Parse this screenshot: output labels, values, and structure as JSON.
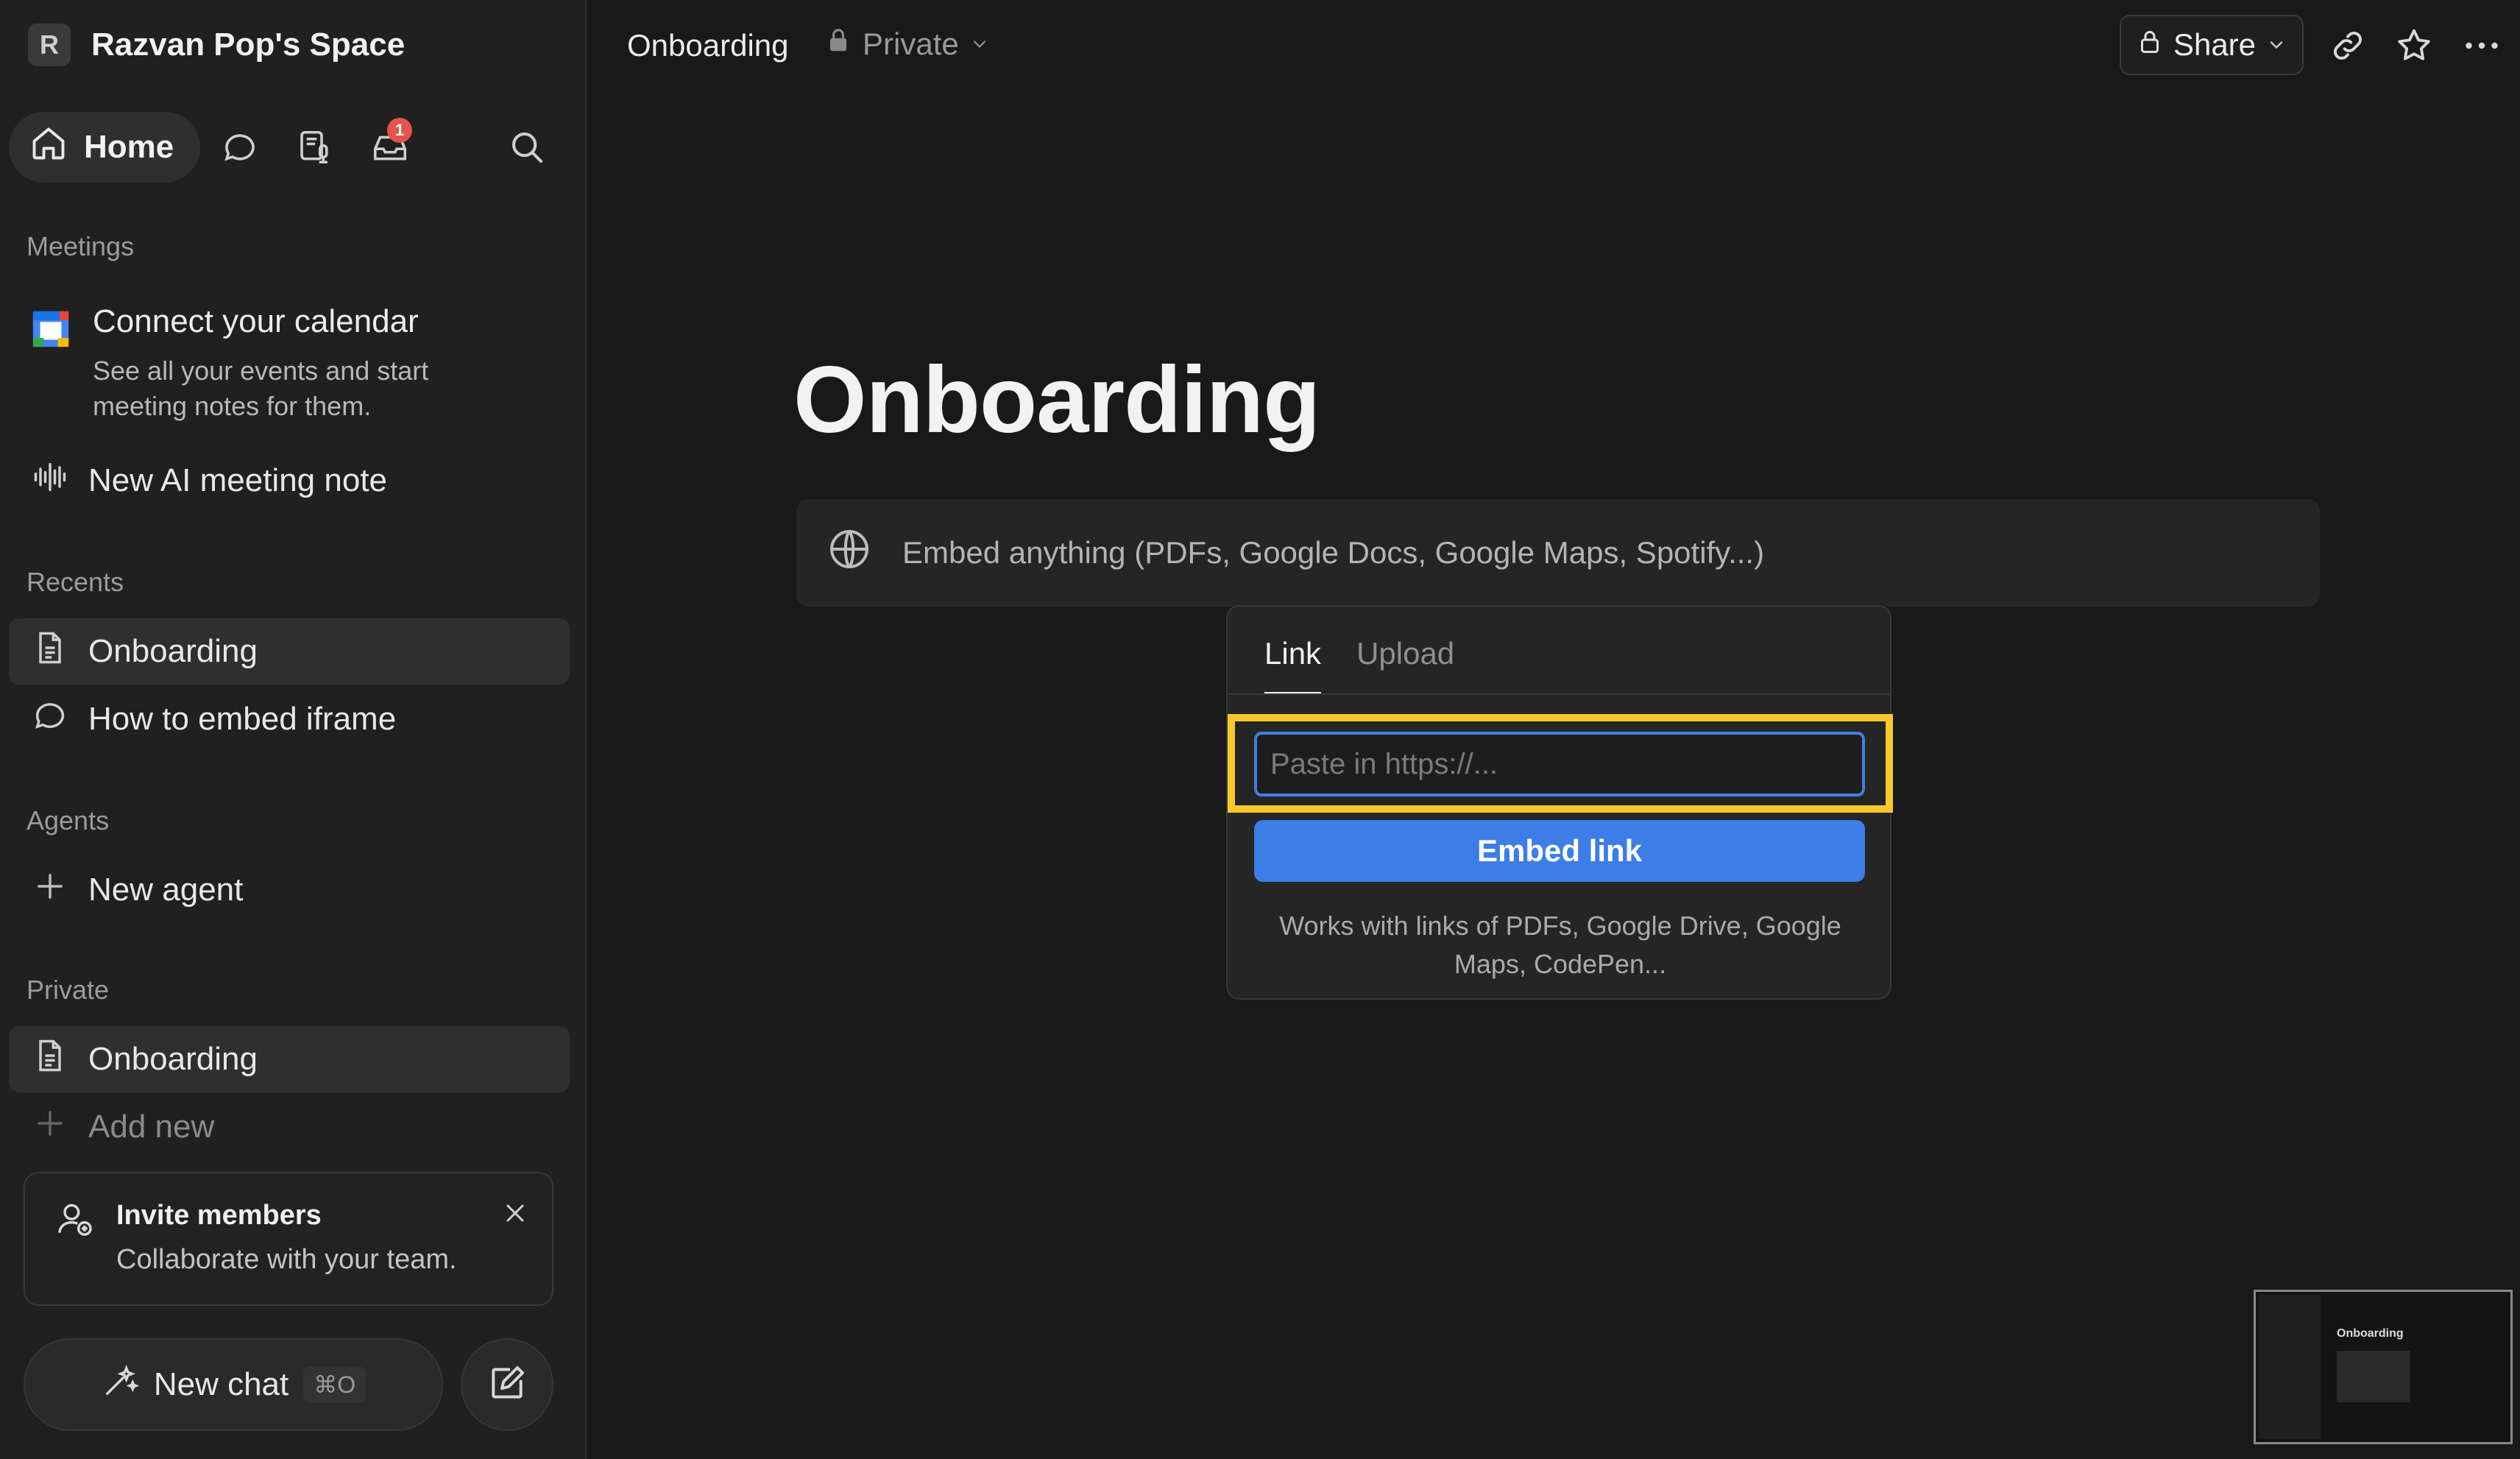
{
  "workspace": {
    "initial": "R",
    "name": "Razvan Pop's Space"
  },
  "nav": {
    "home_label": "Home",
    "inbox_badge": "1"
  },
  "meetings": {
    "section": "Meetings",
    "connect_title": "Connect your calendar",
    "connect_desc": "See all your events and start meeting notes for them.",
    "new_note": "New AI meeting note"
  },
  "recents": {
    "section": "Recents",
    "items": [
      {
        "label": "Onboarding",
        "icon": "page-icon"
      },
      {
        "label": "How to embed iframe",
        "icon": "chat-bubble-icon"
      }
    ]
  },
  "agents": {
    "section": "Agents",
    "new_agent": "New agent"
  },
  "private": {
    "section": "Private",
    "items": [
      {
        "label": "Onboarding",
        "icon": "page-icon"
      }
    ],
    "add_new": "Add new"
  },
  "invite": {
    "title": "Invite members",
    "subtitle": "Collaborate with your team."
  },
  "chat": {
    "new_chat": "New chat",
    "shortcut": "⌘O"
  },
  "topbar": {
    "page_title": "Onboarding",
    "privacy": "Private",
    "share": "Share"
  },
  "page": {
    "title": "Onboarding",
    "embed_placeholder": "Embed anything (PDFs, Google Docs, Google Maps, Spotify...)"
  },
  "embed_popup": {
    "tabs": [
      "Link",
      "Upload"
    ],
    "active_tab": "Link",
    "input_placeholder": "Paste in https://...",
    "button": "Embed link",
    "hint": "Works with links of PDFs, Google Drive, Google Maps, CodePen..."
  },
  "minimap": {
    "title": "Onboarding"
  },
  "colors": {
    "background": "#191919",
    "sidebar": "#202020",
    "accent_blue": "#3c7de6",
    "highlight_yellow": "#f5c92e",
    "badge_red": "#e5534b"
  }
}
